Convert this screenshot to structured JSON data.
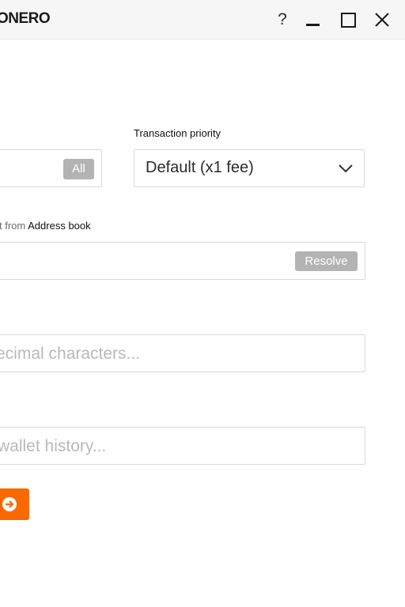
{
  "window": {
    "brand": "ONERO",
    "help_glyph": "?",
    "icons": [
      "help-icon",
      "minimize-icon",
      "maximize-icon",
      "close-icon"
    ]
  },
  "amount": {
    "all_label": "All"
  },
  "priority": {
    "label": "Transaction priority",
    "selected": "Default (x1 fee)",
    "icon": "chevron-down-icon"
  },
  "address": {
    "label_prefix": "t from",
    "label_link": "Address book",
    "resolve_label": "Resolve"
  },
  "payment_id": {
    "placeholder": "ecimal characters..."
  },
  "description": {
    "placeholder": "wallet history..."
  },
  "send": {
    "icon": "arrow-right-circle-icon"
  },
  "colors": {
    "accent": "#fa6800",
    "pill": "#b3b3b3",
    "placeholder": "#b9b9b9"
  }
}
